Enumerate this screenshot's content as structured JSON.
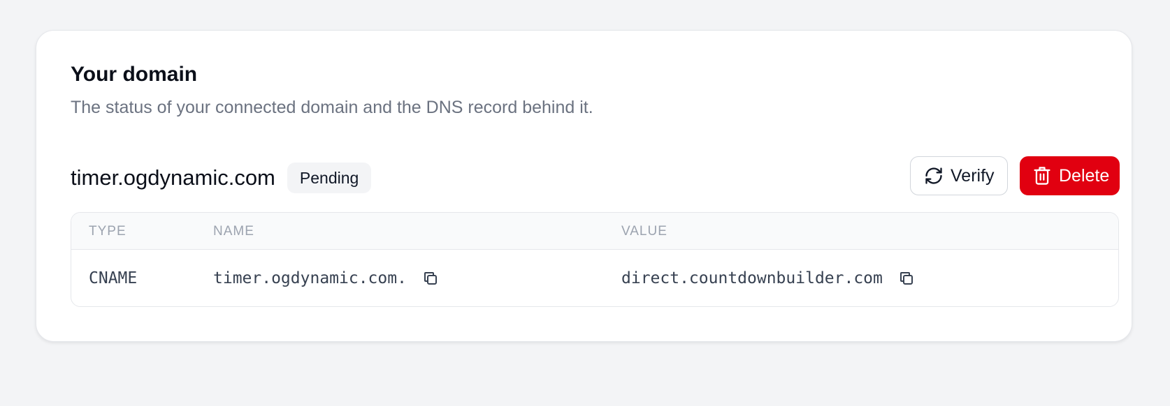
{
  "card": {
    "title": "Your domain",
    "subtitle": "The status of your connected domain and the DNS record behind it."
  },
  "domain": {
    "name": "timer.ogdynamic.com",
    "status": "Pending"
  },
  "actions": {
    "verify_label": "Verify",
    "verify_icon": "refresh-icon",
    "delete_label": "Delete",
    "delete_icon": "trash-icon"
  },
  "records": {
    "columns": [
      "TYPE",
      "NAME",
      "VALUE"
    ],
    "rows": [
      {
        "type": "CNAME",
        "name": "timer.ogdynamic.com.",
        "value": "direct.countdownbuilder.com"
      }
    ]
  },
  "colors": {
    "page_background": "#f3f4f6",
    "card_background": "#ffffff",
    "delete_button": "#e10010",
    "subtitle_text": "#6b7280",
    "table_header_text": "#9ca3af"
  }
}
